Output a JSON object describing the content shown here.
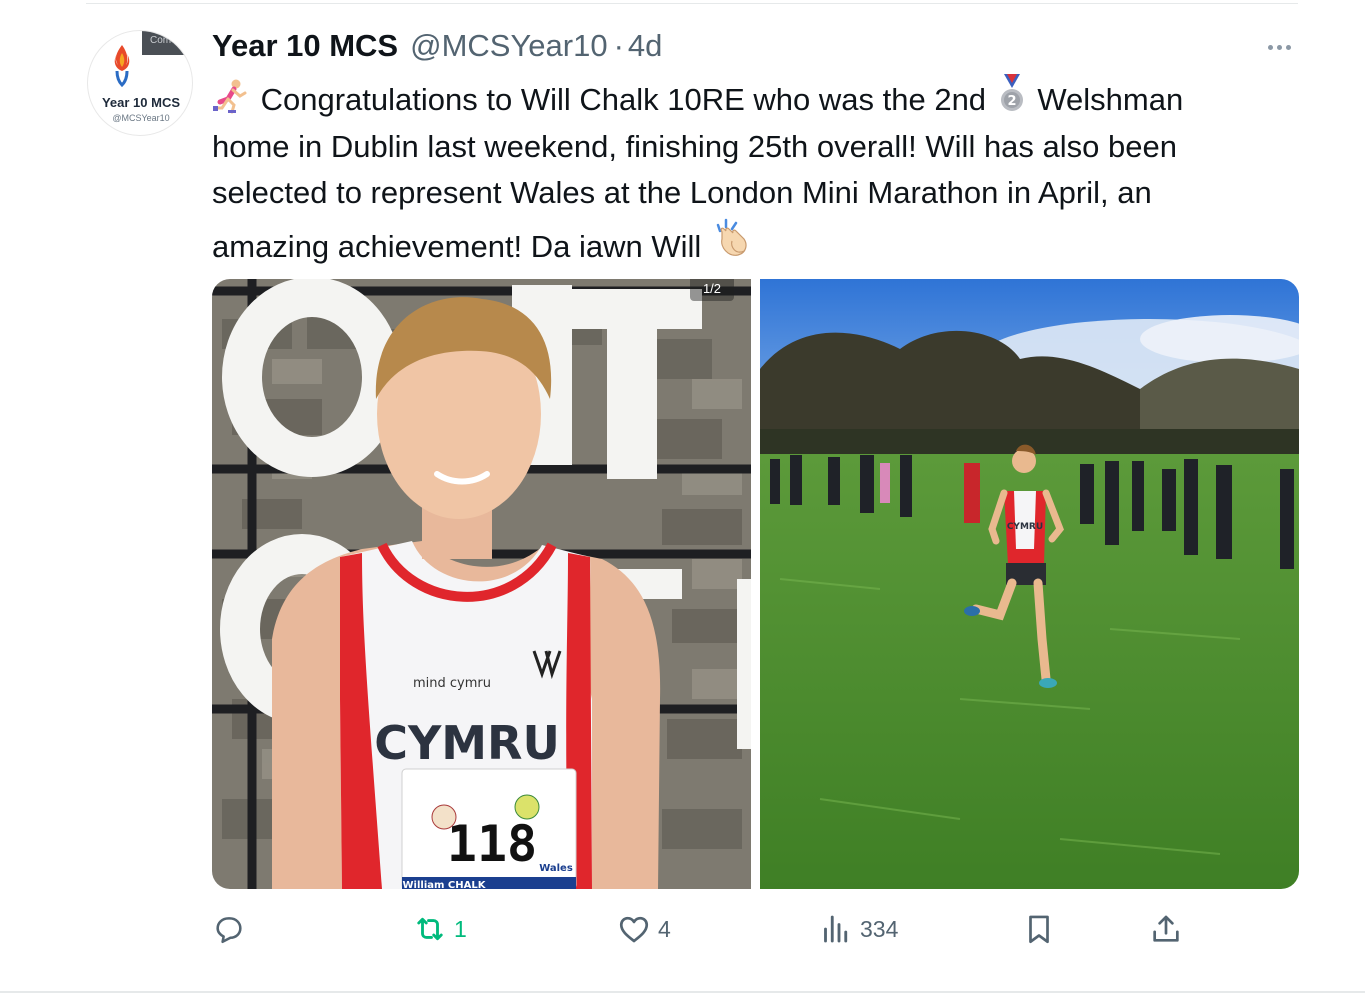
{
  "tweet": {
    "avatar": {
      "label": "Year 10 MCS",
      "handle": "@MCSYear10",
      "band_text": "Com"
    },
    "author": {
      "display_name": "Year 10 MCS",
      "handle": "@MCSYear10",
      "separator": "·",
      "time": "4d"
    },
    "text": {
      "line1_a": "Congratulations to Will Chalk 10RE who was the 2nd",
      "line1_b": "Welshman",
      "line2": "home in Dublin last weekend, finishing 25th overall! Will has also been",
      "line3": "selected to represent Wales at the London Mini Marathon in April, an",
      "line4": "amazing achievement! Da iawn Will",
      "emoji_start": "runner-emoji",
      "emoji_medal": "second-place-medal-emoji",
      "emoji_end": "clapping-hands-emoji"
    },
    "media": {
      "counter": "1/2",
      "photo1": {
        "sign_letters": "ORT",
        "vest_text": "CYMRU",
        "brand_text": "mind cymru",
        "bib_number": "118",
        "bib_name": "William CHALK",
        "bib_region": "Wales"
      },
      "photo2": {
        "vest_text": "CYMRU"
      }
    },
    "actions": {
      "reply": {
        "icon": "reply-icon",
        "count": ""
      },
      "retweet": {
        "icon": "retweet-icon",
        "count": "1"
      },
      "like": {
        "icon": "heart-icon",
        "count": "4"
      },
      "views": {
        "icon": "views-icon",
        "count": "334"
      },
      "bookmark": {
        "icon": "bookmark-icon"
      },
      "share": {
        "icon": "share-icon"
      }
    },
    "colors": {
      "text": "#0f1419",
      "secondary": "#536471",
      "retweet_active": "#00ba7c"
    }
  }
}
